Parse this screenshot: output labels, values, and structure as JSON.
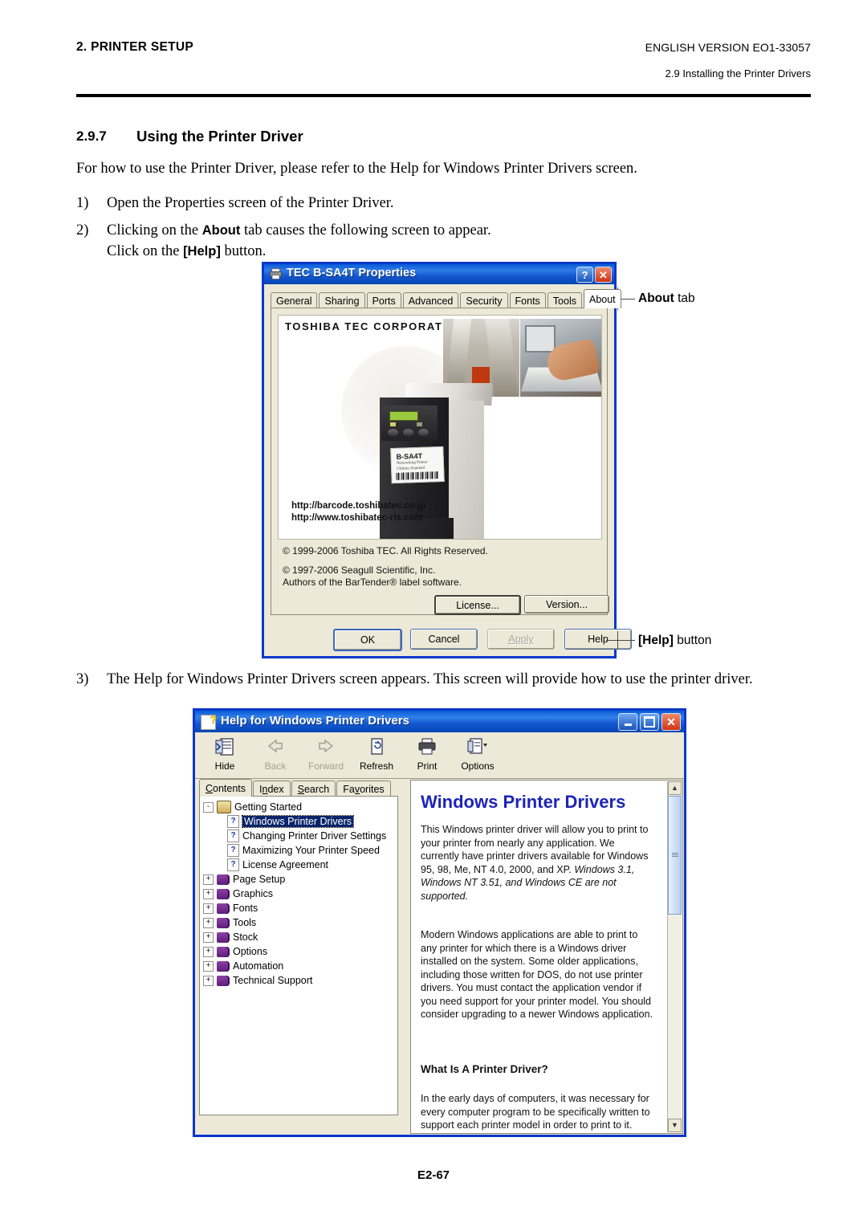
{
  "header": {
    "left": "2. PRINTER SETUP",
    "right": "ENGLISH VERSION EO1-33057",
    "sub": "2.9 Installing the Printer Drivers"
  },
  "section": {
    "number": "2.9.7",
    "title": "Using the Printer Driver",
    "intro": "For how to use the Printer Driver, please refer to the Help for Windows Printer Drivers screen.",
    "steps": [
      {
        "num": "1)",
        "text": "Open the Properties screen of the Printer Driver."
      },
      {
        "num": "2)",
        "text_a": "Clicking on the ",
        "bold_a": "About",
        "text_b": " tab causes the following screen to appear.",
        "text_c": "Click on the ",
        "bold_b": "[Help]",
        "text_d": " button."
      },
      {
        "num": "3)",
        "text": "The Help for Windows Printer Drivers screen appears.  This screen will provide how to use the printer driver."
      }
    ]
  },
  "callouts": {
    "about_bold": "About",
    "about_rest": " tab",
    "help_bold": "[Help]",
    "help_rest": " button"
  },
  "properties_dialog": {
    "title": "TEC B-SA4T Properties",
    "titlebar_buttons": {
      "help": "?",
      "close": "✕"
    },
    "tabs": [
      {
        "label": "General",
        "selected": false
      },
      {
        "label": "Sharing",
        "selected": false
      },
      {
        "label": "Ports",
        "selected": false
      },
      {
        "label": "Advanced",
        "selected": false
      },
      {
        "label": "Security",
        "selected": false
      },
      {
        "label": "Fonts",
        "selected": false
      },
      {
        "label": "Tools",
        "selected": false
      },
      {
        "label": "About",
        "selected": true
      }
    ],
    "banner": {
      "logo": "TOSHIBA TEC CORPORATION",
      "url1": "http://barcode.toshibatec.co.jp",
      "url2": "http://www.toshibatec-ris.com",
      "printer_label_model": "B-SA4T",
      "printer_label_line1": "Networking Printer",
      "printer_label_line2": "Utilities Standard"
    },
    "copyright": [
      "© 1999-2006 Toshiba TEC.  All Rights Reserved.",
      "© 1997-2006 Seagull Scientific, Inc.",
      "Authors of the BarTender® label software."
    ],
    "pane_buttons": [
      {
        "label": "License...",
        "underline": "L",
        "default": true
      },
      {
        "label": "Version...",
        "underline": "V",
        "default": false
      }
    ],
    "footer_buttons": [
      {
        "label": "OK",
        "enabled": true,
        "default": true
      },
      {
        "label": "Cancel",
        "enabled": true,
        "default": false
      },
      {
        "label": "Apply",
        "enabled": false,
        "default": false
      },
      {
        "label": "Help",
        "enabled": true,
        "default": false
      }
    ]
  },
  "help_window": {
    "title": "Help for Windows Printer Drivers",
    "titlebar_buttons": {
      "minimize": "_",
      "maximize": "□",
      "close": "✕"
    },
    "toolbar": [
      {
        "label": "Hide",
        "icon": "hide-icon",
        "enabled": true
      },
      {
        "label": "Back",
        "icon": "back-arrow-icon",
        "enabled": false
      },
      {
        "label": "Forward",
        "icon": "forward-arrow-icon",
        "enabled": false
      },
      {
        "label": "Refresh",
        "icon": "refresh-icon",
        "enabled": true
      },
      {
        "label": "Print",
        "icon": "printer-icon",
        "enabled": true
      },
      {
        "label": "Options",
        "icon": "options-icon",
        "enabled": true
      }
    ],
    "tabs": [
      {
        "label": "Contents",
        "selected": true
      },
      {
        "label": "Index",
        "selected": false
      },
      {
        "label": "Search",
        "selected": false
      },
      {
        "label": "Favorites",
        "selected": false
      }
    ],
    "tree": [
      {
        "label": "Getting Started",
        "type": "book-open",
        "toggle": "-",
        "indent": 0,
        "selected": false
      },
      {
        "label": "Windows Printer Drivers",
        "type": "topic",
        "toggle": "",
        "indent": 1,
        "selected": true
      },
      {
        "label": "Changing Printer Driver Settings",
        "type": "topic",
        "toggle": "",
        "indent": 1,
        "selected": false
      },
      {
        "label": "Maximizing Your Printer Speed",
        "type": "topic",
        "toggle": "",
        "indent": 1,
        "selected": false
      },
      {
        "label": "License Agreement",
        "type": "topic",
        "toggle": "",
        "indent": 1,
        "selected": false
      },
      {
        "label": "Page Setup",
        "type": "book",
        "toggle": "+",
        "indent": 0,
        "selected": false
      },
      {
        "label": "Graphics",
        "type": "book",
        "toggle": "+",
        "indent": 0,
        "selected": false
      },
      {
        "label": "Fonts",
        "type": "book",
        "toggle": "+",
        "indent": 0,
        "selected": false
      },
      {
        "label": "Tools",
        "type": "book",
        "toggle": "+",
        "indent": 0,
        "selected": false
      },
      {
        "label": "Stock",
        "type": "book",
        "toggle": "+",
        "indent": 0,
        "selected": false
      },
      {
        "label": "Options",
        "type": "book",
        "toggle": "+",
        "indent": 0,
        "selected": false
      },
      {
        "label": "Automation",
        "type": "book",
        "toggle": "+",
        "indent": 0,
        "selected": false
      },
      {
        "label": "Technical Support",
        "type": "book",
        "toggle": "+",
        "indent": 0,
        "selected": false
      }
    ],
    "content": {
      "title": "Windows Printer Drivers",
      "para1_plain": "This Windows printer driver will allow you to print to your printer from nearly any application.  We currently have printer drivers available for Windows 95, 98, Me, NT 4.0, 2000, and XP. ",
      "para1_italic": "Windows 3.1, Windows NT 3.51, and Windows CE are not supported.",
      "para2": "Modern Windows applications are able to print to any printer for which there is a Windows driver installed on the system.  Some older applications, including those written for DOS, do not use printer drivers.  You must contact the application vendor if you need support for your printer model.  You should consider upgrading to a newer Windows application.",
      "heading2": "What Is A Printer Driver?",
      "para3": "In the early days of computers, it was necessary for every computer program to be specifically written to support each printer model in order to print to it.  This"
    },
    "scrollbar": {
      "up": "▲",
      "down": "▼"
    }
  },
  "footer": {
    "page": "E2-67"
  },
  "colors": {
    "window_border": "#0a37c8",
    "titlebar": "#0a5ad6",
    "dialog_face": "#ece9d8",
    "help_title": "#1d24b8",
    "selection": "#0a246a"
  }
}
